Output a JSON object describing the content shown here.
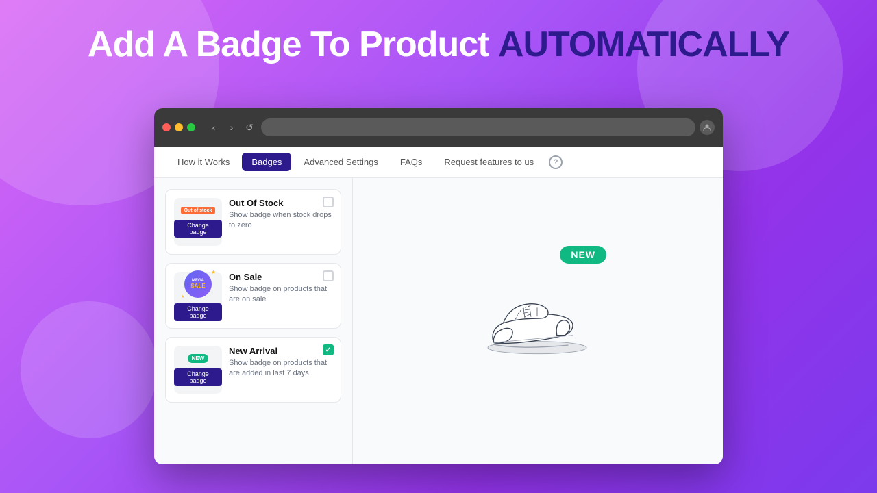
{
  "headline": {
    "part1": "Add A Badge To Product ",
    "part2": "AUTOMATICALLY"
  },
  "browser": {
    "url": "",
    "nav": {
      "back": "‹",
      "forward": "›",
      "refresh": "↺"
    }
  },
  "tabs": [
    {
      "id": "how-it-works",
      "label": "How it Works",
      "active": false
    },
    {
      "id": "badges",
      "label": "Badges",
      "active": true
    },
    {
      "id": "advanced-settings",
      "label": "Advanced Settings",
      "active": false
    },
    {
      "id": "faqs",
      "label": "FAQs",
      "active": false
    },
    {
      "id": "request-features",
      "label": "Request features to us",
      "active": false
    }
  ],
  "badges": [
    {
      "id": "out-of-stock",
      "title": "Out Of Stock",
      "description": "Show badge when stock drops to zero",
      "badge_text": "Out of stock",
      "badge_type": "out-of-stock",
      "checked": false,
      "change_btn": "Change badge"
    },
    {
      "id": "on-sale",
      "title": "On Sale",
      "description": "Show badge on products that are on sale",
      "badge_text": "MEGA SALE",
      "badge_type": "mega-sale",
      "checked": false,
      "change_btn": "Change badge"
    },
    {
      "id": "new-arrival",
      "title": "New Arrival",
      "description": "Show badge on products that are added in last 7 days",
      "badge_text": "NEW",
      "badge_type": "new",
      "checked": true,
      "change_btn": "Change badge"
    }
  ],
  "preview": {
    "new_badge_text": "NEW"
  }
}
